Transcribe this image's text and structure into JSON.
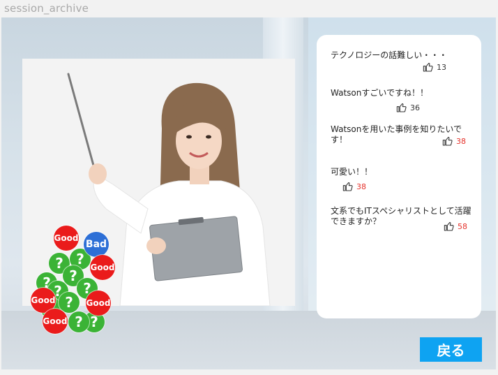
{
  "app": {
    "title": "session_archive"
  },
  "comments": [
    {
      "text": "テクノロジーの話難しい・・・",
      "likes": "13",
      "highlight": false
    },
    {
      "text": "Watsonすごいですね！！",
      "likes": "36",
      "highlight": false
    },
    {
      "text": "Watsonを用いた事例を知りたいです！",
      "likes": "38",
      "highlight": true
    },
    {
      "text": "可愛い！！",
      "likes": "38",
      "highlight": true
    },
    {
      "text": "文系でもITスペシャリストとして活躍できますか？",
      "likes": "58",
      "highlight": true
    }
  ],
  "reactions": {
    "good_label": "Good",
    "bad_label": "Bad",
    "question_label": "?"
  },
  "back_button": {
    "label": "戻る"
  },
  "colors": {
    "good": "#ea1b1b",
    "bad": "#2d6fd6",
    "question": "#3bb336",
    "accent": "#0ea3f2",
    "like_highlight": "#e5322b"
  }
}
